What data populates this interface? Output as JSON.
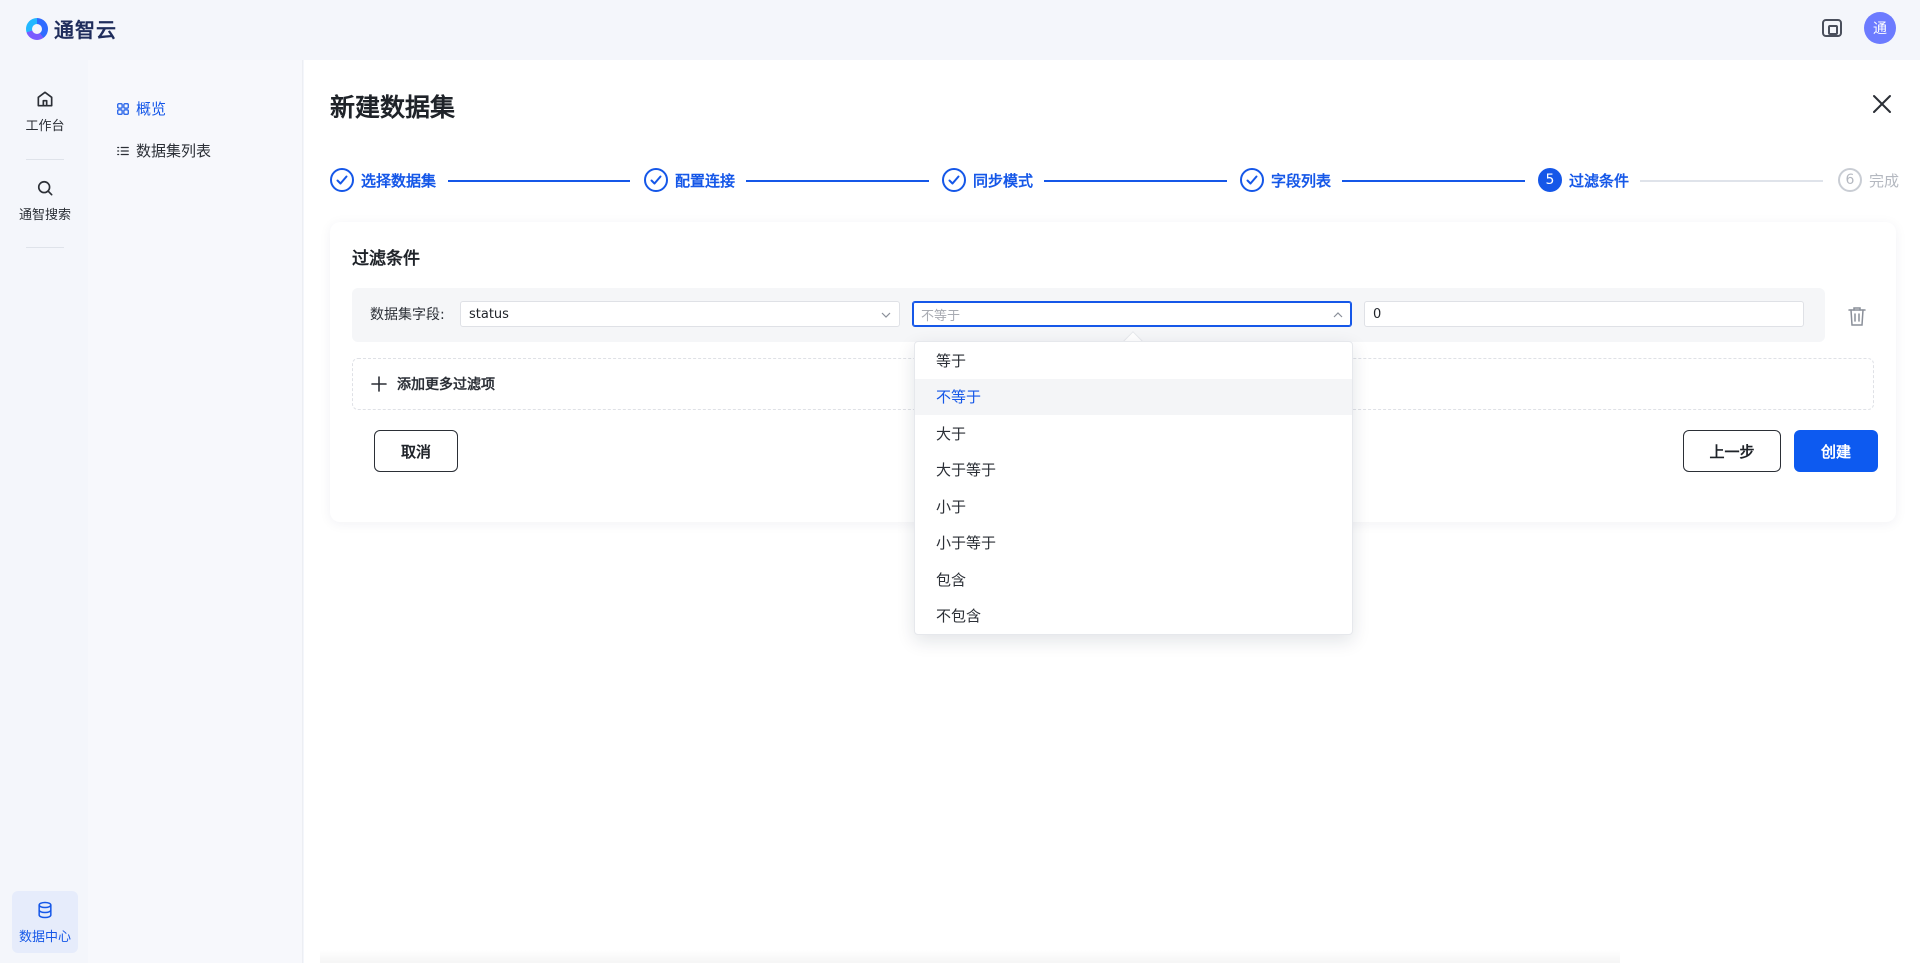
{
  "app": {
    "name": "通智云",
    "avatar_text": "通"
  },
  "rail": {
    "items": [
      {
        "label": "工作台",
        "icon": "home-icon"
      },
      {
        "label": "通智搜索",
        "icon": "search-icon"
      },
      {
        "label": "数据中心",
        "icon": "database-icon"
      }
    ]
  },
  "subnav": {
    "items": [
      {
        "label": "概览",
        "icon": "grid-icon",
        "active": true
      },
      {
        "label": "数据集列表",
        "icon": "list-icon",
        "active": false
      }
    ]
  },
  "page": {
    "title": "新建数据集"
  },
  "steps": [
    {
      "label": "选择数据集",
      "status": "done"
    },
    {
      "label": "配置连接",
      "status": "done"
    },
    {
      "label": "同步模式",
      "status": "done"
    },
    {
      "label": "字段列表",
      "status": "done"
    },
    {
      "label": "过滤条件",
      "status": "current",
      "number": "5"
    },
    {
      "label": "完成",
      "status": "todo",
      "number": "6"
    }
  ],
  "filter": {
    "title": "过滤条件",
    "field_label": "数据集字段:",
    "field_value": "status",
    "operator_placeholder": "不等于",
    "value": "0",
    "add_label": "添加更多过滤项"
  },
  "buttons": {
    "cancel": "取消",
    "prev": "上一步",
    "create": "创建"
  },
  "operator_options": [
    "等于",
    "不等于",
    "大于",
    "大于等于",
    "小于",
    "小于等于",
    "包含",
    "不包含"
  ],
  "selected_option": "不等于",
  "colors": {
    "primary": "#1557e8",
    "button_primary": "#0d5af0"
  }
}
